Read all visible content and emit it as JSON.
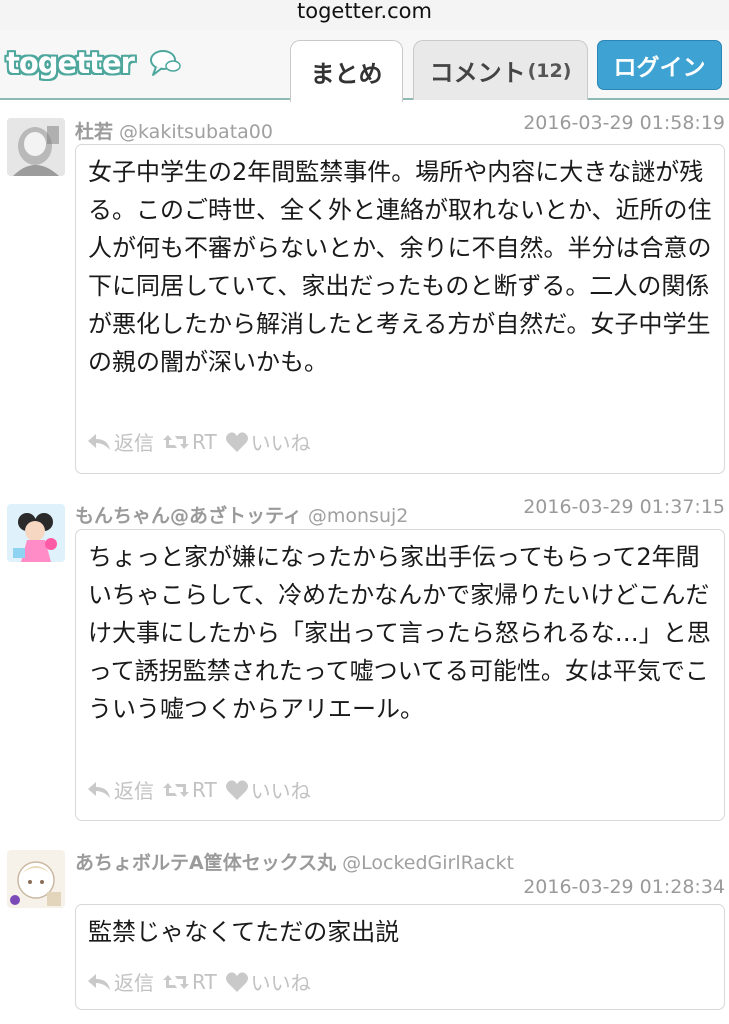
{
  "browser": {
    "url": "togetter.com"
  },
  "header": {
    "logo": "togetter",
    "tabs": [
      {
        "label": "まとめ",
        "active": true
      },
      {
        "label": "コメント",
        "count": "(12)",
        "active": false
      }
    ],
    "login_label": "ログイン"
  },
  "colors": {
    "brand": "#4ea79d",
    "login": "#3ea3d3",
    "meta_text": "#9a9a9a",
    "action_text": "#c2c2c2"
  },
  "tweets": [
    {
      "name": "杜若",
      "handle": "@kakitsubata00",
      "time": "2016-03-29 01:58:19",
      "text": "女子中学生の2年間監禁事件。場所や内容に大きな謎が残る。このご時世、全く外と連絡が取れないとか、近所の住人が何も不審がらないとか、余りに不自然。半分は合意の下に同居していて、家出だったものと断ずる。二人の関係が悪化したから解消したと考える方が自然だ。女子中学生の親の闇が深いかも。",
      "actions": {
        "reply": "返信",
        "retweet": "RT",
        "like": "いいね"
      }
    },
    {
      "name": "もんちゃん@あざトッティ",
      "handle": "@monsuj2",
      "time": "2016-03-29 01:37:15",
      "text": "ちょっと家が嫌になったから家出手伝ってもらって2年間いちゃこらして、冷めたかなんかで家帰りたいけどこんだけ大事にしたから「家出って言ったら怒られるな…」と思って誘拐監禁されたって嘘ついてる可能性。女は平気でこういう嘘つくからアリエール。",
      "actions": {
        "reply": "返信",
        "retweet": "RT",
        "like": "いいね"
      }
    },
    {
      "name": "あちょボルテA筐体セックス丸",
      "handle": "@LockedGirlRackt",
      "time": "2016-03-29 01:28:34",
      "text": "監禁じゃなくてただの家出説",
      "actions": {
        "reply": "返信",
        "retweet": "RT",
        "like": "いいね"
      }
    }
  ]
}
